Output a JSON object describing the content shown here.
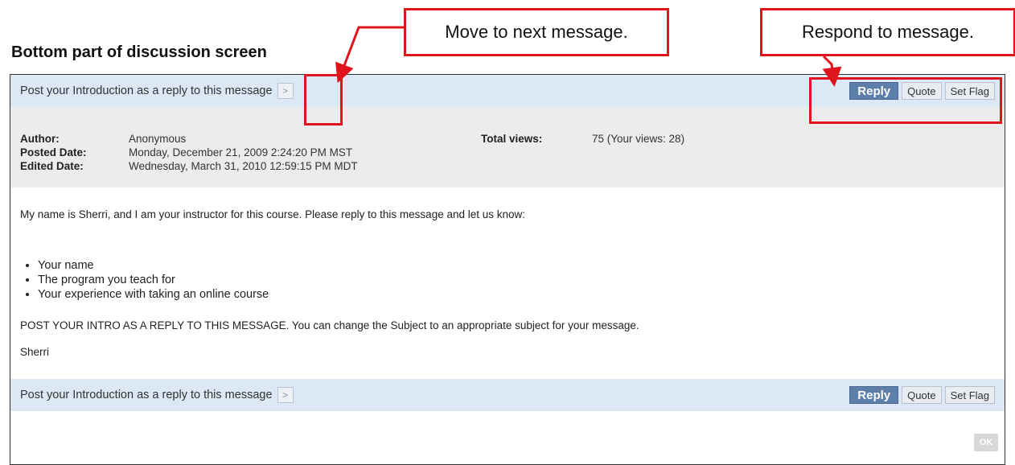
{
  "caption": "Bottom part of discussion screen",
  "callouts": {
    "next": "Move to next message.",
    "respond": "Respond to message."
  },
  "topbar": {
    "text": "Post your Introduction as a reply to this message",
    "next_symbol": ">",
    "reply": "Reply",
    "quote": "Quote",
    "setflag": "Set Flag"
  },
  "meta": {
    "author_label": "Author:",
    "author": "Anonymous",
    "posted_label": "Posted Date:",
    "posted": "Monday, December 21, 2009 2:24:20 PM MST",
    "edited_label": "Edited Date:",
    "edited": "Wednesday, March 31, 2010 12:59:15 PM MDT",
    "views_label": "Total views:",
    "views": "75 (Your views: 28)"
  },
  "message": {
    "intro": "My name is Sherri, and I am your instructor for this course.  Please reply to this message and let us know:",
    "bullets": [
      "Your name",
      "The program you teach for",
      "Your experience with taking an online course"
    ],
    "instruction": "POST YOUR INTRO AS A REPLY TO THIS MESSAGE.  You can change the Subject to an appropriate subject for your message.",
    "signature": "Sherri"
  },
  "bottombar": {
    "text": "Post your Introduction as a reply to this message",
    "next_symbol": ">",
    "reply": "Reply",
    "quote": "Quote",
    "setflag": "Set Flag"
  },
  "ok_label": "OK",
  "colors": {
    "callout_red": "#e0141c",
    "bar_blue": "#dce8f5",
    "reply_blue": "#5f7fab",
    "meta_gray": "#ececec"
  }
}
